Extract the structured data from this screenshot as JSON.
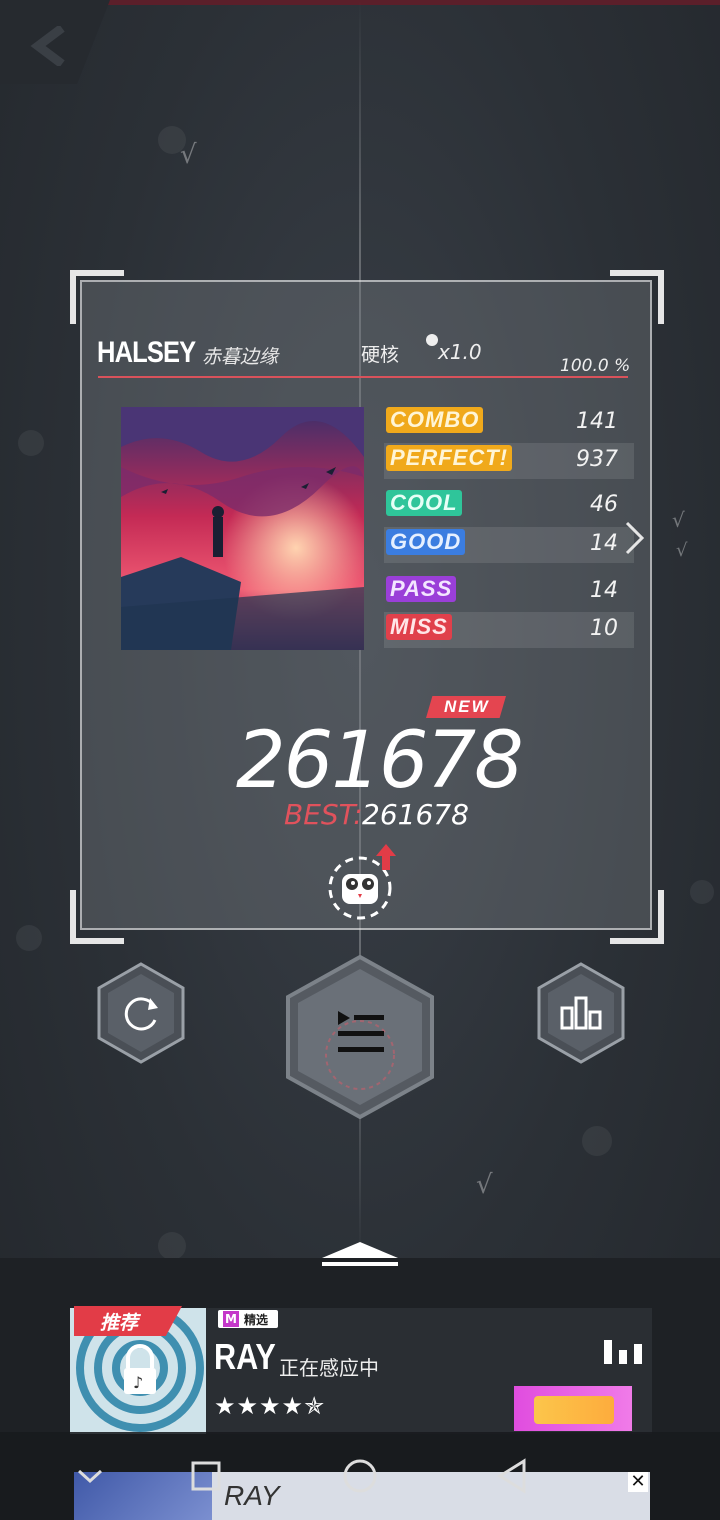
{
  "song": {
    "artist": "HALSEY",
    "title": "赤暮边缘",
    "difficulty": "硬核",
    "speed": "x1.0",
    "accuracy": "100.0 %"
  },
  "judgements": [
    {
      "label": "COMBO",
      "value": "141",
      "color": "#f0a91b"
    },
    {
      "label": "PERFECT!",
      "value": "937",
      "color": "#f0a91b"
    },
    {
      "label": "COOL",
      "value": "46",
      "color": "#2fc59a"
    },
    {
      "label": "GOOD",
      "value": "14",
      "color": "#3b7de0"
    },
    {
      "label": "PASS",
      "value": "14",
      "color": "#9a3fd8"
    },
    {
      "label": "MISS",
      "value": "10",
      "color": "#e0404b"
    }
  ],
  "result": {
    "new_badge": "NEW",
    "score": "261678",
    "best_label": "BEST:",
    "best_value": "261678"
  },
  "recommend": {
    "tag": "推荐",
    "m_tag": "M",
    "m_label": "精选",
    "title": "RAY",
    "status": "正在感应中",
    "stars": "★★★★✯"
  },
  "ad": {
    "title": "RAY",
    "close": "✕"
  },
  "colors": {
    "accent_red": "#e23c47",
    "panel_border": "#e6e6e6"
  }
}
